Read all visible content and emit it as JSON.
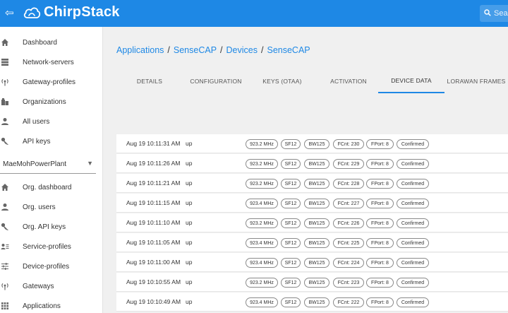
{
  "app": {
    "name": "ChirpStack",
    "search_placeholder": "Sear"
  },
  "sidebar": {
    "global_items": [
      {
        "label": "Dashboard",
        "icon": "home-icon"
      },
      {
        "label": "Network-servers",
        "icon": "server-icon"
      },
      {
        "label": "Gateway-profiles",
        "icon": "radio-tower-icon"
      },
      {
        "label": "Organizations",
        "icon": "building-icon"
      },
      {
        "label": "All users",
        "icon": "user-icon"
      },
      {
        "label": "API keys",
        "icon": "key-icon"
      }
    ],
    "organization": "MaeMohPowerPlant",
    "org_items": [
      {
        "label": "Org. dashboard",
        "icon": "home-icon"
      },
      {
        "label": "Org. users",
        "icon": "user-icon"
      },
      {
        "label": "Org. API keys",
        "icon": "key-icon"
      },
      {
        "label": "Service-profiles",
        "icon": "account-details-icon"
      },
      {
        "label": "Device-profiles",
        "icon": "tune-icon"
      },
      {
        "label": "Gateways",
        "icon": "radio-tower-icon"
      },
      {
        "label": "Applications",
        "icon": "apps-grid-icon"
      }
    ]
  },
  "breadcrumb": {
    "applications": "Applications",
    "app_name": "SenseCAP",
    "devices": "Devices",
    "device_name": "SenseCAP",
    "separator": "/"
  },
  "tabs": [
    {
      "label": "DETAILS",
      "active": false
    },
    {
      "label": "CONFIGURATION",
      "active": false
    },
    {
      "label": "KEYS (OTAA)",
      "active": false
    },
    {
      "label": "ACTIVATION",
      "active": false
    },
    {
      "label": "DEVICE DATA",
      "active": true
    },
    {
      "label": "LORAWAN FRAMES",
      "active": false
    }
  ],
  "frames": [
    {
      "time": "Aug 19 10:11:31 AM",
      "direction": "up",
      "chips": [
        "923.2 MHz",
        "SF12",
        "BW125",
        "FCnt: 230",
        "FPort: 8",
        "Confirmed"
      ]
    },
    {
      "time": "Aug 19 10:11:26 AM",
      "direction": "up",
      "chips": [
        "923.2 MHz",
        "SF12",
        "BW125",
        "FCnt: 229",
        "FPort: 8",
        "Confirmed"
      ]
    },
    {
      "time": "Aug 19 10:11:21 AM",
      "direction": "up",
      "chips": [
        "923.2 MHz",
        "SF12",
        "BW125",
        "FCnt: 228",
        "FPort: 8",
        "Confirmed"
      ]
    },
    {
      "time": "Aug 19 10:11:15 AM",
      "direction": "up",
      "chips": [
        "923.4 MHz",
        "SF12",
        "BW125",
        "FCnt: 227",
        "FPort: 8",
        "Confirmed"
      ]
    },
    {
      "time": "Aug 19 10:11:10 AM",
      "direction": "up",
      "chips": [
        "923.2 MHz",
        "SF12",
        "BW125",
        "FCnt: 226",
        "FPort: 8",
        "Confirmed"
      ]
    },
    {
      "time": "Aug 19 10:11:05 AM",
      "direction": "up",
      "chips": [
        "923.4 MHz",
        "SF12",
        "BW125",
        "FCnt: 225",
        "FPort: 8",
        "Confirmed"
      ]
    },
    {
      "time": "Aug 19 10:11:00 AM",
      "direction": "up",
      "chips": [
        "923.4 MHz",
        "SF12",
        "BW125",
        "FCnt: 224",
        "FPort: 8",
        "Confirmed"
      ]
    },
    {
      "time": "Aug 19 10:10:55 AM",
      "direction": "up",
      "chips": [
        "923.2 MHz",
        "SF12",
        "BW125",
        "FCnt: 223",
        "FPort: 8",
        "Confirmed"
      ]
    },
    {
      "time": "Aug 19 10:10:49 AM",
      "direction": "up",
      "chips": [
        "923.4 MHz",
        "SF12",
        "BW125",
        "FCnt: 222",
        "FPort: 8",
        "Confirmed"
      ]
    }
  ],
  "colors": {
    "primary": "#1e88e5",
    "background": "#f0f0f0"
  }
}
